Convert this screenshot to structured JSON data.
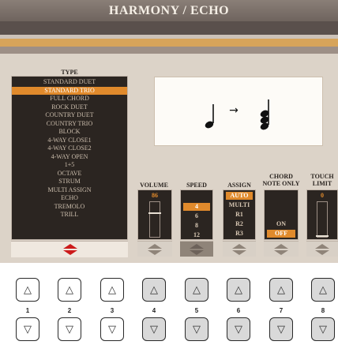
{
  "title": "HARMONY / ECHO",
  "type": {
    "header": "TYPE",
    "items": [
      "STANDARD DUET",
      "STANDARD TRIO",
      "FULL CHORD",
      "ROCK DUET",
      "COUNTRY DUET",
      "COUNTRY TRIO",
      "BLOCK",
      "4-WAY CLOSE1",
      "4-WAY CLOSE2",
      "4-WAY OPEN",
      "1+5",
      "OCTAVE",
      "STRUM",
      "MULTI ASSIGN",
      "ECHO",
      "TREMOLO",
      "TRILL"
    ],
    "selected": "STANDARD TRIO"
  },
  "notation_arrow": "→",
  "volume": {
    "label": "VOLUME",
    "value": "86",
    "level_percent": 68
  },
  "speed": {
    "label": "SPEED",
    "options": [
      "4",
      "6",
      "8",
      "12"
    ],
    "selected": "4"
  },
  "assign": {
    "label": "ASSIGN",
    "options": [
      "AUTO",
      "MULTI",
      "R1",
      "R2",
      "R3"
    ],
    "selected": "AUTO"
  },
  "chord_note_only": {
    "label_line1": "CHORD",
    "label_line2": "NOTE ONLY",
    "options": [
      "ON",
      "OFF"
    ],
    "selected": "OFF"
  },
  "touch_limit": {
    "label_line1": "TOUCH",
    "label_line2": "LIMIT",
    "value": "0"
  },
  "up_arrow": "△",
  "down_arrow": "▽",
  "button_numbers": [
    "1",
    "2",
    "3",
    "4",
    "5",
    "6",
    "7",
    "8"
  ],
  "colors": {
    "accent": "#e08a2c",
    "panel": "#2b2521",
    "background": "#dcd3c8",
    "red_arrows": "#cc1b1b"
  }
}
